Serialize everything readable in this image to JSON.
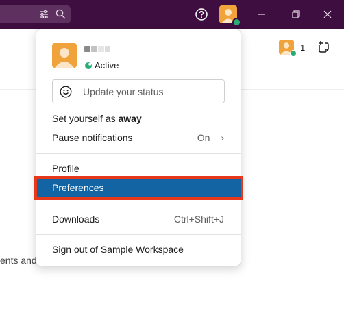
{
  "header": {
    "mentions_count": "1"
  },
  "background_text": "ents and",
  "colors": {
    "titlebar": "#3f0e40",
    "highlight": "#1264a3",
    "annotation": "#e8381c",
    "presence": "#2bac76",
    "avatar": "#f0a33a"
  },
  "menu": {
    "presence": "Active",
    "status_placeholder": "Update your status",
    "away_prefix": "Set yourself as ",
    "away_bold": "away",
    "pause_label": "Pause notifications",
    "pause_value": "On",
    "pause_chevron": "›",
    "profile": "Profile",
    "preferences": "Preferences",
    "downloads": "Downloads",
    "downloads_shortcut": "Ctrl+Shift+J",
    "sign_out": "Sign out of Sample Workspace"
  }
}
